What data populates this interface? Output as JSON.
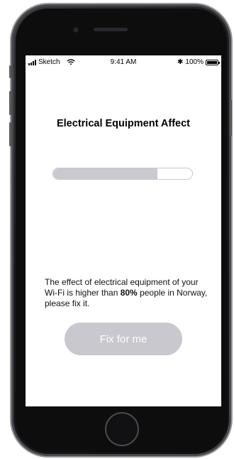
{
  "status_bar": {
    "carrier": "Sketch",
    "time": "9:41 AM",
    "bluetooth": "✱",
    "battery_percent": "100%",
    "battery_level": 1.0
  },
  "screen": {
    "title": "Electrical Equipment Affect",
    "progress": 0.75,
    "message_before": "The effect of electrical equipment of your Wi-Fi is higher than ",
    "message_percent": "80%",
    "message_after": " people in Norway, please fix it.",
    "button_label": "Fix for me"
  },
  "colors": {
    "progress_fill": "#c9c9cf",
    "button_bg": "#c8c8ce",
    "button_text": "#ffffff"
  },
  "icons": {
    "signal": "cellular-signal-icon",
    "wifi": "wifi-icon",
    "bluetooth": "bluetooth-icon",
    "battery": "battery-icon"
  }
}
